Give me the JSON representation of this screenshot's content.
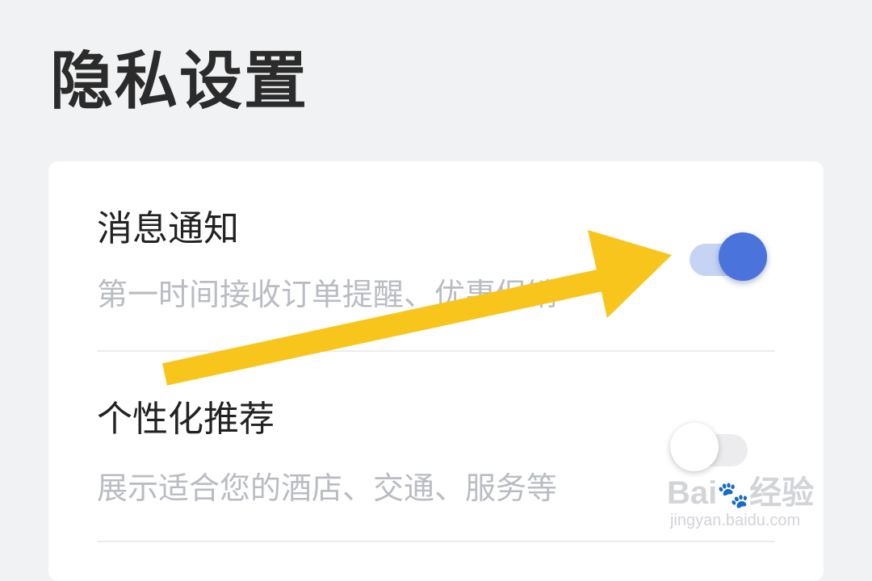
{
  "page": {
    "title": "隐私设置"
  },
  "settings": [
    {
      "title": "消息通知",
      "description": "第一时间接收订单提醒、优惠促销",
      "enabled": true
    },
    {
      "title": "个性化推荐",
      "description": "展示适合您的酒店、交通、服务等",
      "enabled": false
    }
  ],
  "colors": {
    "accent": "#4a74dc",
    "accent_track": "#c6d4f4",
    "arrow": "#f8c51c",
    "background": "#f1f2f4"
  },
  "annotation": {
    "icon": "arrow-icon"
  },
  "watermark": {
    "logo": "Baidu经验",
    "url": "jingyan.baidu.com"
  }
}
